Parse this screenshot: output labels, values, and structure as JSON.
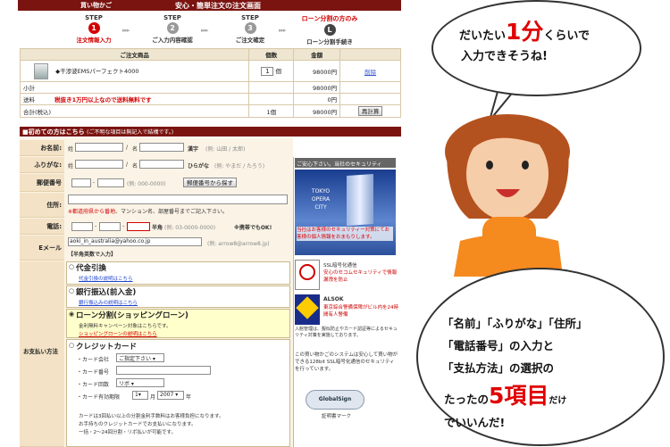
{
  "header": {
    "cart": "買い物かご",
    "title": "安心・簡単注文の注文画面"
  },
  "steps": [
    {
      "label": "STEP",
      "num": "1",
      "sub": "注文情報入力",
      "active": true
    },
    {
      "label": "STEP",
      "num": "2",
      "sub": "ご入力内容確認",
      "active": false
    },
    {
      "label": "STEP",
      "num": "3",
      "sub": "ご注文確定",
      "active": false
    },
    {
      "label": "ローン分割の方のみ",
      "num": "L",
      "sub": "ローン分割手続き",
      "active": false
    }
  ],
  "order": {
    "col_product": "ご注文商品",
    "col_qty": "個数",
    "col_amount": "金額",
    "product_name": "◆干渉波EMSパーフェクト4000",
    "qty": "1",
    "qty_unit": "個",
    "price": "98000円",
    "delete": "削除",
    "subtotal_label": "小計",
    "subtotal": "98000円",
    "shipping_label": "送料",
    "shipping_note": "税抜き1万円以上なので送料無料です",
    "shipping": "0円",
    "total_label": "合計(税込)",
    "total_qty": "1個",
    "total": "98000円",
    "recalc": "再計算"
  },
  "form": {
    "section_title": "■初めての方はこちら",
    "section_sub": "(ご不明な項目は無記入で結構です。)",
    "name_label": "お名前",
    "sei": "姓",
    "mei": "名",
    "name_hint": "漢字",
    "name_ex": "(例: 山田 / 太郎)",
    "kana_label": "ふりがな",
    "kana_hint": "ひらがな",
    "kana_ex": "(例: やまだ / たろう)",
    "zip_label": "郵便番号",
    "zip_ex": "(例: 000-0000)",
    "zip_button": "郵便番号から探す",
    "addr_label": "住所",
    "addr_note_red": "※都道府県から番地",
    "addr_note": "、マンション名、部屋番号までご記入下さい。",
    "tel_label": "電話",
    "tel_hint": "半角",
    "tel_ex": "(例: 03-0000-0000)",
    "tel_note": "※携帯でもOK!",
    "email_label": "Eメール",
    "email_value": "aoki_in_australia@yahoo.co.jp",
    "email_ex": "(例: arrow8@arrow8.jp)",
    "email_hint": "【半角英数で入力】",
    "pay_label": "お支払い方法"
  },
  "payment": [
    {
      "title": "代金引換",
      "link": "代金引換の説明はこちら"
    },
    {
      "title": "銀行振込(前入金)",
      "link": "銀行振込みの説明はこちら"
    },
    {
      "title": "ローン分割(ショッピングローン)",
      "link": "ショッピングローンの説明はこちら",
      "note": "金利無料キャンペーン対象はこちらです。"
    },
    {
      "title": "クレジットカード"
    }
  ],
  "credit": {
    "company_label": "・カード会社",
    "company_value": "ご指定下さい",
    "number_label": "・カード番号",
    "split_label": "・カード回数",
    "split_value": "リボ",
    "expiry_label": "・カード有効期限",
    "month": "1",
    "month_unit": "月",
    "year": "2007",
    "year_unit": "年",
    "note1": "カードは3回払い以上の分割金利手数料はお客様負担になります。",
    "note2": "お手持ちのクレジットカードでお支払いになります。",
    "note3": "一括・2～24回分割・リボ払いが可能です。"
  },
  "security": {
    "header": "ご安心下さい。当社のセキュリティ",
    "tower_text": "TOKYO OPERA CITY",
    "tower_caption": "当社はお客様のセキュリティー対策にてお客様の個人情報をおまもりします。",
    "ssl_title": "SSL暗号化通信",
    "ssl_desc": "安心のセコムセキュリティで情報漏洩を防止",
    "alsok_title": "ALSOK",
    "alsok_desc": "東京綜合警備保障がビル内を24時間有人警備",
    "alsok_note": "入館管理は、擬似防止やカード認証等によるセキュリティ対策を実施しております。",
    "ssl_note": "この買い物かごのシステムは安心して買い物ができる128bit SSL暗号化通信のセキュリティを行っています。",
    "globalsign": "GlobalSign",
    "globalsign_caption": "証明書マーク"
  },
  "bubble_top": {
    "line1_pre": "だいたい",
    "big": "1分",
    "line1_post": "くらいで",
    "line2": "入力できそうね!"
  },
  "bubble_bottom": {
    "line1": "「名前」「ふりがな」「住所」",
    "line2": "「電話番号」の入力と",
    "line3": "「支払方法」の選択の",
    "line4_pre": "たったの",
    "big": "5項目",
    "line4_post": "だけ",
    "line5": "でいいんだ!"
  },
  "colors": {
    "maroon": "#7a1410",
    "accent_red": "#e00000",
    "form_bg": "#f3e2c6",
    "loan_bg": "#ffffcc"
  }
}
